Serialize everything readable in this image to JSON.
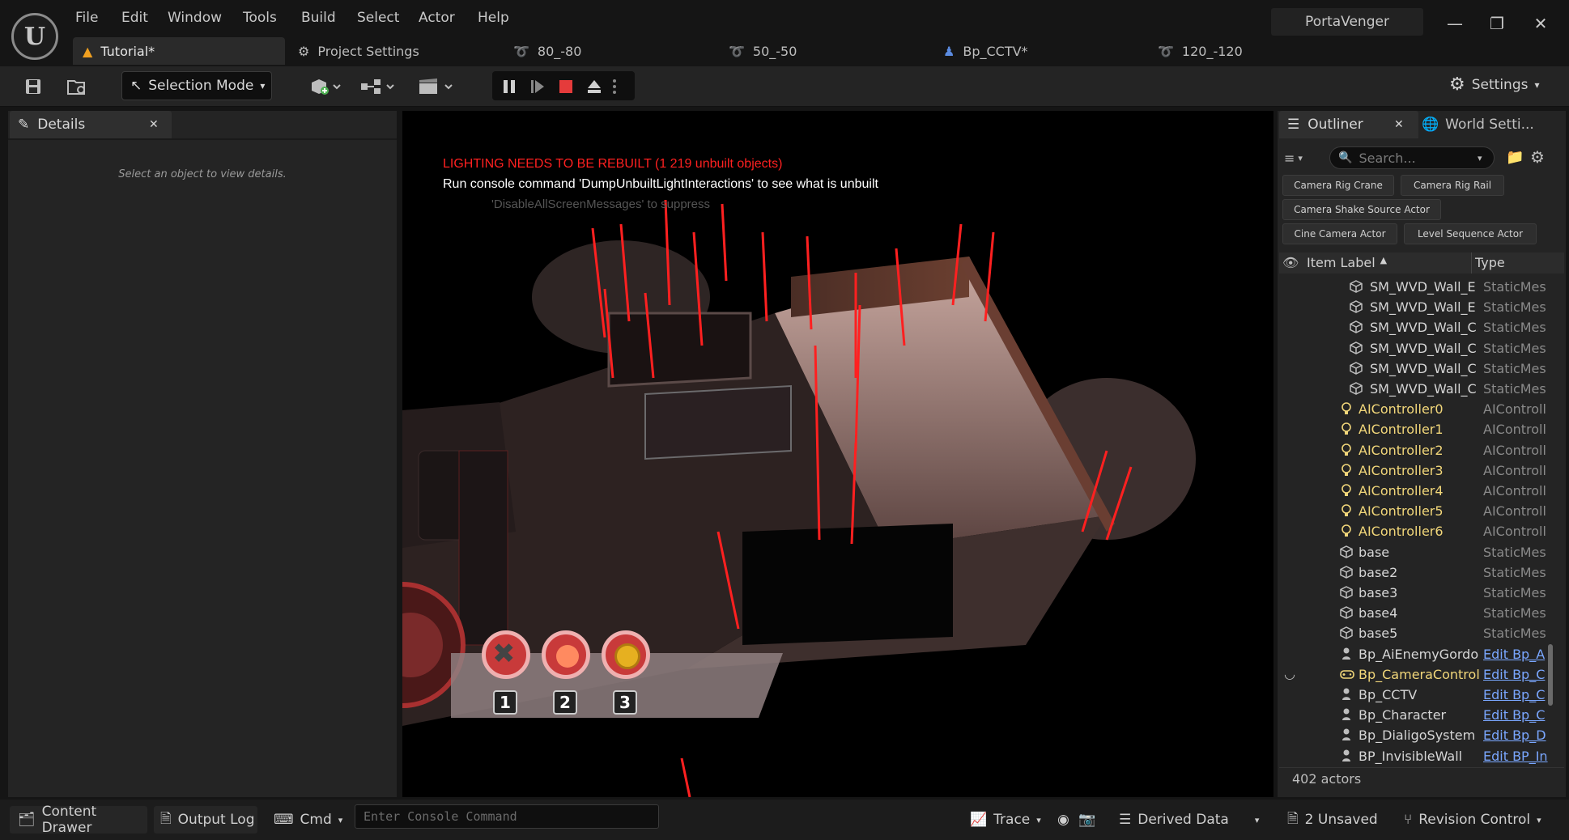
{
  "title_bar": {
    "menus": [
      "File",
      "Edit",
      "Window",
      "Tools",
      "Build",
      "Select",
      "Actor",
      "Help"
    ],
    "project_name": "PortaVenger"
  },
  "tabs": [
    {
      "label": "Tutorial*",
      "icon": "level-icon",
      "active": true
    },
    {
      "label": "Project Settings",
      "icon": "settings-cog-icon",
      "active": false
    },
    {
      "label": "80_-80",
      "icon": "curve-asset-icon",
      "active": false
    },
    {
      "label": "50_-50",
      "icon": "curve-asset-icon",
      "active": false
    },
    {
      "label": "Bp_CCTV*",
      "icon": "blueprint-actor-icon",
      "active": false
    },
    {
      "label": "120_-120",
      "icon": "curve-asset-icon",
      "active": false
    }
  ],
  "toolbar": {
    "selection_mode": "Selection Mode",
    "settings": "Settings"
  },
  "details": {
    "tab_label": "Details",
    "empty_message": "Select an object to view details."
  },
  "viewport": {
    "warning": "LIGHTING NEEDS TO BE REBUILT (1 219 unbuilt objects)",
    "hint": "Run console command 'DumpUnbuiltLightInteractions' to see what is unbuilt",
    "faded_hint": "'DisableAllScreenMessages' to suppress",
    "hud_slots": [
      "1",
      "2",
      "3"
    ]
  },
  "outliner": {
    "tab_label": "Outliner",
    "world_settings_tab": "World Setti...",
    "search_placeholder": "Search...",
    "filters": [
      "Camera Rig Crane",
      "Camera Rig Rail",
      "Camera Shake Source Actor",
      "Cine Camera Actor",
      "Level Sequence Actor"
    ],
    "columns": {
      "label": "Item Label",
      "type": "Type"
    },
    "rows": [
      {
        "label": "SM_WVD_Wall_E",
        "type": "StaticMes",
        "kind": "mesh",
        "indent": 2
      },
      {
        "label": "SM_WVD_Wall_E",
        "type": "StaticMes",
        "kind": "mesh",
        "indent": 2
      },
      {
        "label": "SM_WVD_Wall_C",
        "type": "StaticMes",
        "kind": "mesh",
        "indent": 2
      },
      {
        "label": "SM_WVD_Wall_C",
        "type": "StaticMes",
        "kind": "mesh",
        "indent": 2
      },
      {
        "label": "SM_WVD_Wall_C",
        "type": "StaticMes",
        "kind": "mesh",
        "indent": 2
      },
      {
        "label": "SM_WVD_Wall_C",
        "type": "StaticMes",
        "kind": "mesh",
        "indent": 2
      },
      {
        "label": "AIController0",
        "type": "AIControll",
        "kind": "ai",
        "indent": 1
      },
      {
        "label": "AIController1",
        "type": "AIControll",
        "kind": "ai",
        "indent": 1
      },
      {
        "label": "AIController2",
        "type": "AIControll",
        "kind": "ai",
        "indent": 1
      },
      {
        "label": "AIController3",
        "type": "AIControll",
        "kind": "ai",
        "indent": 1
      },
      {
        "label": "AIController4",
        "type": "AIControll",
        "kind": "ai",
        "indent": 1
      },
      {
        "label": "AIController5",
        "type": "AIControll",
        "kind": "ai",
        "indent": 1
      },
      {
        "label": "AIController6",
        "type": "AIControll",
        "kind": "ai",
        "indent": 1
      },
      {
        "label": "base",
        "type": "StaticMes",
        "kind": "mesh",
        "indent": 1
      },
      {
        "label": "base2",
        "type": "StaticMes",
        "kind": "mesh",
        "indent": 1
      },
      {
        "label": "base3",
        "type": "StaticMes",
        "kind": "mesh",
        "indent": 1
      },
      {
        "label": "base4",
        "type": "StaticMes",
        "kind": "mesh",
        "indent": 1
      },
      {
        "label": "base5",
        "type": "StaticMes",
        "kind": "mesh",
        "indent": 1
      },
      {
        "label": "Bp_AiEnemyGordo",
        "type": "Edit Bp_A",
        "kind": "pawn",
        "indent": 1
      },
      {
        "label": "Bp_CameraControl",
        "type": "Edit Bp_C",
        "kind": "gamepad",
        "indent": 1
      },
      {
        "label": "Bp_CCTV",
        "type": "Edit Bp_C",
        "kind": "pawn",
        "indent": 1
      },
      {
        "label": "Bp_Character",
        "type": "Edit Bp_C",
        "kind": "pawn",
        "indent": 1
      },
      {
        "label": "Bp_DialigoSystem",
        "type": "Edit Bp_D",
        "kind": "pawn",
        "indent": 1
      },
      {
        "label": "BP_InvisibleWall",
        "type": "Edit BP_In",
        "kind": "pawn",
        "indent": 1
      }
    ],
    "actor_count": "402 actors"
  },
  "status_bar": {
    "content_drawer": "Content Drawer",
    "output_log": "Output Log",
    "cmd": "Cmd",
    "console_placeholder": "Enter Console Command",
    "trace": "Trace",
    "derived_data": "Derived Data",
    "unsaved": "2 Unsaved",
    "revision_control": "Revision Control"
  },
  "colors": {
    "warning_red": "#ff2020",
    "ai_yellow": "#f2d77a",
    "link_blue": "#7aa7ff",
    "stop_red": "#e53b3b"
  }
}
